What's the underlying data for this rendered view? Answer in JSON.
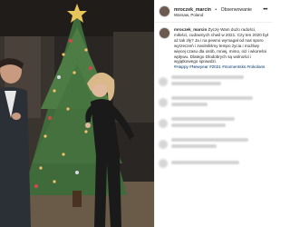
{
  "post": {
    "header": {
      "username": "mroczek_marcin",
      "separator": "•",
      "follow_label": "Obserwowanie",
      "location": "Warsaw, Poland",
      "more_icon": "more-horizontal-icon"
    },
    "caption": {
      "username": "mroczek_marcin",
      "text": "Życzę Wam dużo radości, miłości, cudownych chwil w 2021. Czy ten 2020 był aż tak zły? Ja i na pewno wymagał od nas sporo wyrzeczeń i zwolniliśmy tempo życia i możliwy więcej czasu dla osób, mniej, mimo, niż i wkoreśni wpływu. Dlatego Dlodobrych są wolności i wyjątkowego sprawdzi.",
      "hashtags": "#Happy #Newyear #2021 #momentsks #rokolans"
    },
    "photo": {
      "description_colors": {
        "tree": "#3f6b3a",
        "lights": "#f5c16c",
        "dress": "#1a1a1a",
        "suit": "#2b2f36",
        "hair": "#d9b98a"
      }
    }
  }
}
